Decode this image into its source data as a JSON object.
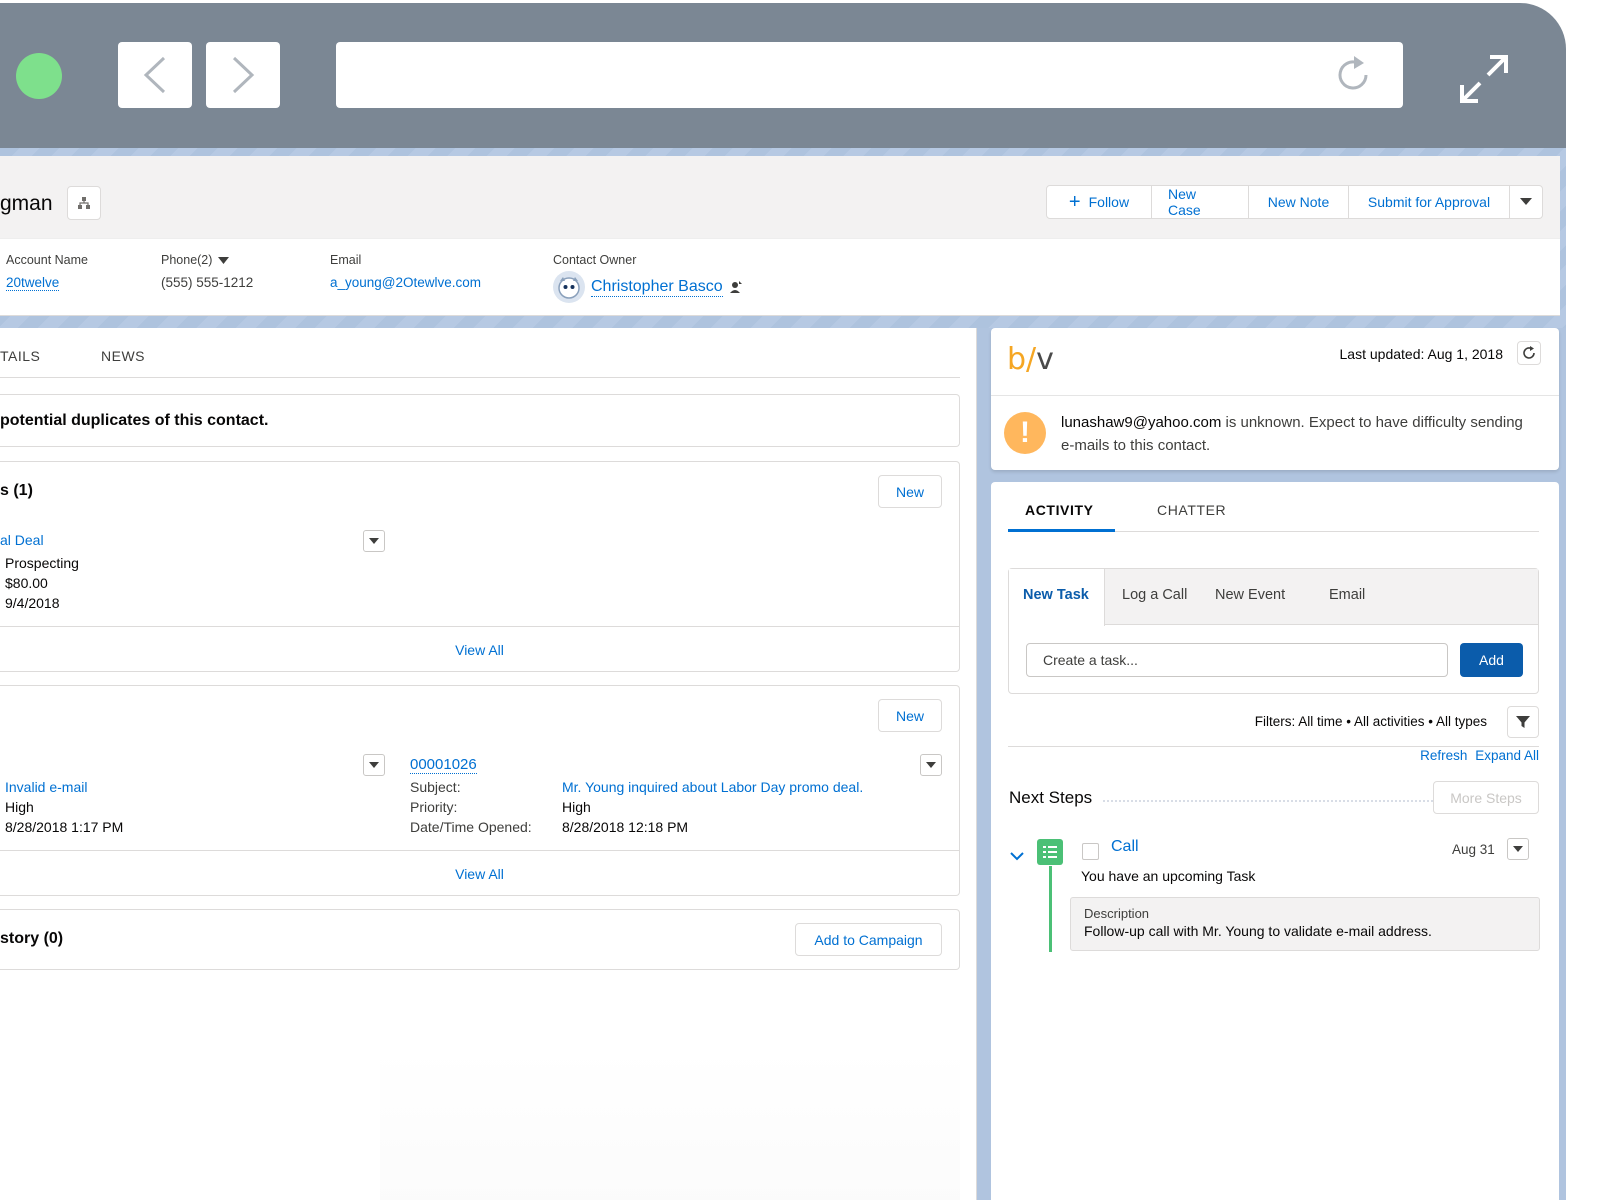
{
  "header": {
    "record_name": "gman",
    "buttons": {
      "follow": "Follow",
      "new_case": "New Case",
      "new_note": "New Note",
      "submit": "Submit for Approval"
    },
    "fields": {
      "account_name_label": "Account Name",
      "account_name_value": "20twelve",
      "phone_label": "Phone(2)",
      "phone_value": "(555) 555-1212",
      "email_label": "Email",
      "email_value": "a_young@2Otewlve.com",
      "owner_label": "Contact Owner",
      "owner_value": "Christopher Basco"
    }
  },
  "main": {
    "tabs": [
      "TAILS",
      "NEWS"
    ],
    "duplicates_text": "potential duplicates of this contact.",
    "opportunities": {
      "title": "s (1)",
      "new_label": "New",
      "deal_name": "al Deal",
      "stage": "Prospecting",
      "amount": "$80.00",
      "close_date": "9/4/2018",
      "view_all": "View All"
    },
    "cases": {
      "new_label": "New",
      "left_reason": "Invalid e-mail",
      "left_priority": "High",
      "left_opened": "8/28/2018 1:17 PM",
      "case_number": "00001026",
      "subject_label": "Subject:",
      "priority_label": "Priority:",
      "opened_label": "Date/Time Opened:",
      "subject_value": "Mr. Young inquired about Labor Day promo deal.",
      "priority_value": "High",
      "opened_value": "8/28/2018 12:18 PM",
      "view_all": "View All"
    },
    "campaign": {
      "title": "story (0)",
      "button": "Add to Campaign"
    }
  },
  "briteverify": {
    "logo_b": "b",
    "logo_slash": "/",
    "logo_v": "v",
    "last_updated": "Last updated: Aug 1, 2018",
    "email": "lunashaw9@yahoo.com",
    "message": " is unknown. Expect to have difficulty sending e-mails to this contact.",
    "warn_symbol": "!"
  },
  "activity": {
    "tabs": [
      "ACTIVITY",
      "CHATTER"
    ],
    "composer_tabs": [
      "New Task",
      "Log a Call",
      "New Event",
      "Email"
    ],
    "task_placeholder": "Create a task...",
    "add_label": "Add",
    "filters": "Filters: All time • All activities • All types",
    "refresh": "Refresh",
    "expand_all": "Expand All",
    "next_steps": "Next Steps",
    "more_steps": "More Steps",
    "task": {
      "title": "Call",
      "date": "Aug 31",
      "subtitle": "You have an upcoming Task",
      "description_label": "Description",
      "description": "Follow-up call with Mr. Young to validate e-mail address."
    }
  },
  "colors": {
    "brand_blue": "#0070d2",
    "button_blue": "#0b5cab",
    "warning": "#ffb75d",
    "task_green": "#4bc076",
    "frame_gray": "#7b8794",
    "traffic_green": "#7ee08c"
  }
}
